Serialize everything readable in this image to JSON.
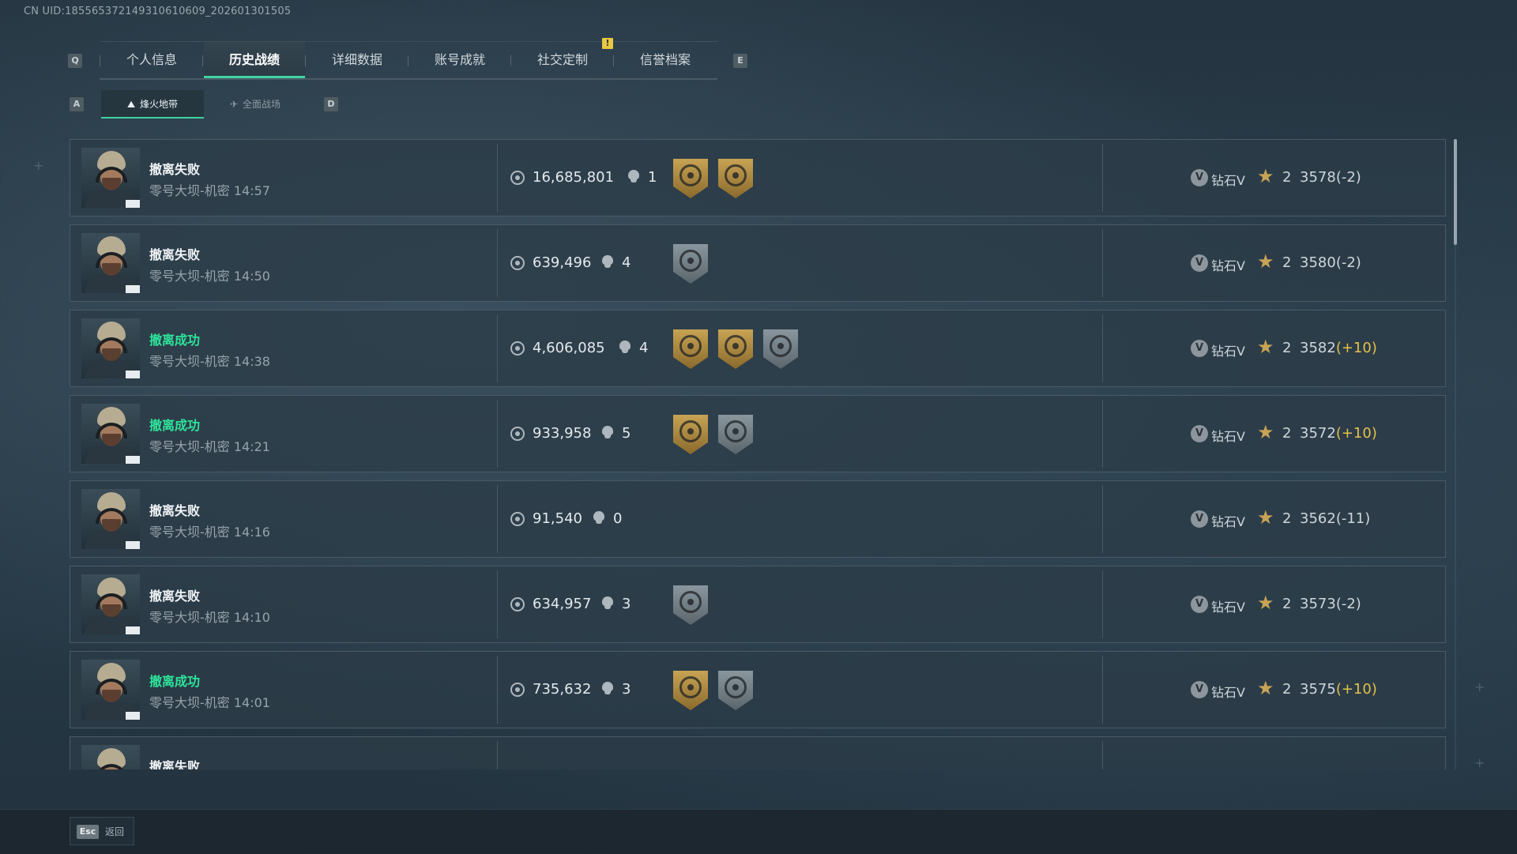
{
  "uid_text": "CN UID:18556537214931061060​9_202601301505",
  "top_tabs": {
    "left_key": "Q",
    "right_key": "E",
    "notification": "!",
    "items": [
      {
        "label": "个人信息"
      },
      {
        "label": "历史战绩"
      },
      {
        "label": "详细数据"
      },
      {
        "label": "账号成就"
      },
      {
        "label": "社交定制"
      },
      {
        "label": "信誉档案"
      }
    ],
    "active_index": 1
  },
  "sub_tabs": {
    "left_key": "A",
    "right_key": "D",
    "items": [
      {
        "label": "烽火地带",
        "icon": "hazard-zone-icon"
      },
      {
        "label": "全面战场",
        "icon": "battlefield-icon"
      }
    ],
    "active_index": 0
  },
  "matches": [
    {
      "status": "撤离失败",
      "success": false,
      "map": "零号大坝-机密",
      "time": "14:57",
      "value": "16,685,801",
      "kills": "1",
      "badges": [
        "gold",
        "gold"
      ],
      "rank": "钻石V",
      "rank_icon": "V",
      "stars": "2",
      "score": "3578",
      "delta": "(-2)"
    },
    {
      "status": "撤离失败",
      "success": false,
      "map": "零号大坝-机密",
      "time": "14:50",
      "value": "639,496",
      "kills": "4",
      "badges": [
        "silver"
      ],
      "rank": "钻石V",
      "rank_icon": "V",
      "stars": "2",
      "score": "3580",
      "delta": "(-2)"
    },
    {
      "status": "撤离成功",
      "success": true,
      "map": "零号大坝-机密",
      "time": "14:38",
      "value": "4,606,085",
      "kills": "4",
      "badges": [
        "gold",
        "gold",
        "silver"
      ],
      "rank": "钻石V",
      "rank_icon": "V",
      "stars": "2",
      "score": "3582",
      "delta": "(+10)"
    },
    {
      "status": "撤离成功",
      "success": true,
      "map": "零号大坝-机密",
      "time": "14:21",
      "value": "933,958",
      "kills": "5",
      "badges": [
        "gold",
        "silver"
      ],
      "rank": "钻石V",
      "rank_icon": "V",
      "stars": "2",
      "score": "3572",
      "delta": "(+10)"
    },
    {
      "status": "撤离失败",
      "success": false,
      "map": "零号大坝-机密",
      "time": "14:16",
      "value": "91,540",
      "kills": "0",
      "badges": [],
      "rank": "钻石V",
      "rank_icon": "V",
      "stars": "2",
      "score": "3562",
      "delta": "(-11)"
    },
    {
      "status": "撤离失败",
      "success": false,
      "map": "零号大坝-机密",
      "time": "14:10",
      "value": "634,957",
      "kills": "3",
      "badges": [
        "silver"
      ],
      "rank": "钻石V",
      "rank_icon": "V",
      "stars": "2",
      "score": "3573",
      "delta": "(-2)"
    },
    {
      "status": "撤离成功",
      "success": true,
      "map": "零号大坝-机密",
      "time": "14:01",
      "value": "735,632",
      "kills": "3",
      "badges": [
        "gold",
        "silver"
      ],
      "rank": "钻石V",
      "rank_icon": "V",
      "stars": "2",
      "score": "3575",
      "delta": "(+10)"
    },
    {
      "status": "撤离失败",
      "success": false,
      "map": "",
      "time": "",
      "value": "",
      "kills": "",
      "badges": [],
      "rank": "",
      "rank_icon": "",
      "stars": "",
      "score": "",
      "delta": ""
    }
  ],
  "footer": {
    "back_key": "Esc",
    "back_label": "返回"
  },
  "colors": {
    "accent": "#3fd3a2",
    "success": "#2ee39a",
    "positive_delta": "#e6c04a",
    "badge_gold": "#c8a354",
    "badge_silver": "#8a969e"
  }
}
